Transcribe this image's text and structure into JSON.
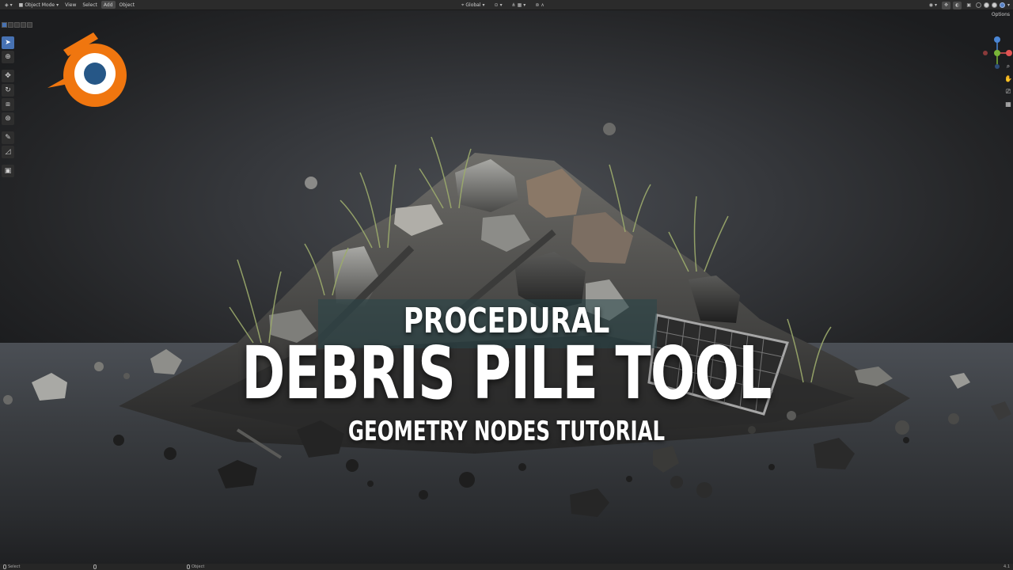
{
  "header": {
    "mode_label": "Object Mode",
    "menus": [
      {
        "label": "View"
      },
      {
        "label": "Select"
      },
      {
        "label": "Add"
      },
      {
        "label": "Object"
      }
    ],
    "orientation_label": "Global",
    "options_label": "Options"
  },
  "title": {
    "line1": "PROCEDURAL",
    "line2": "DEBRIS PILE TOOL",
    "line3": "GEOMETRY NODES TUTORIAL"
  },
  "statusbar": {
    "left_label": "Select",
    "right_label": "Object",
    "version": "4.1"
  },
  "icons": {
    "logo": "blender-logo",
    "tools": [
      "select-box-icon",
      "cursor-icon",
      "move-icon",
      "rotate-icon",
      "scale-icon",
      "transform-icon",
      "annotate-icon",
      "measure-icon",
      "add-cube-icon"
    ],
    "nav": [
      "zoom-icon",
      "pan-icon",
      "camera-icon",
      "grid-icon"
    ]
  },
  "colors": {
    "accent": "#4772b3",
    "logo_orange": "#f0760f",
    "logo_blue": "#265787",
    "gizmo_x": "#e25454",
    "gizmo_y": "#7ab638",
    "gizmo_z": "#4a86d6"
  }
}
